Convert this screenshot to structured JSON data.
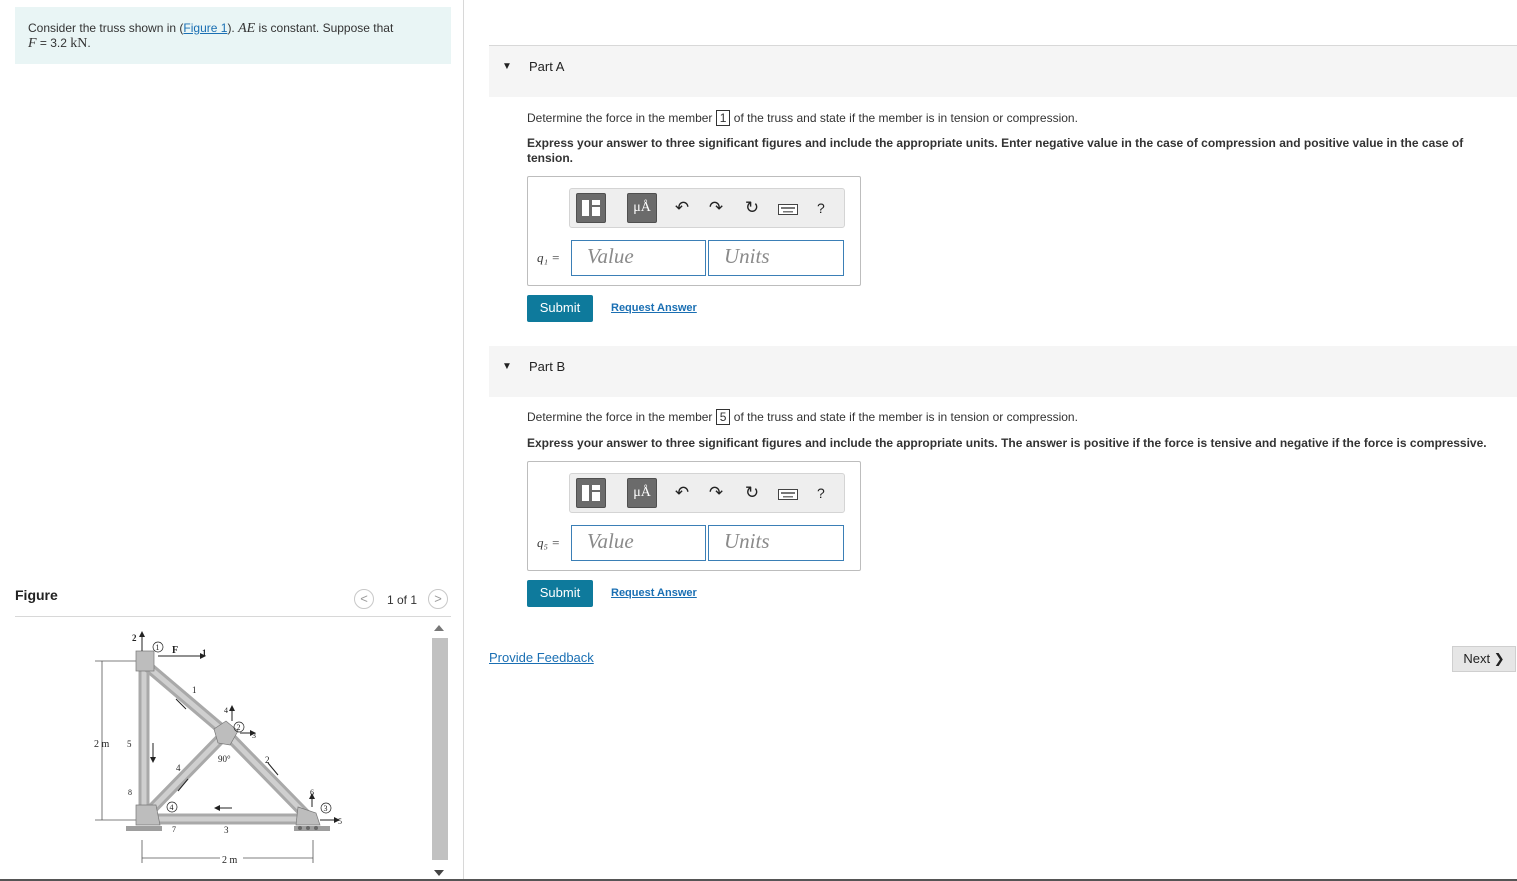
{
  "intro": {
    "text_before_link": "Consider the truss shown in (",
    "figure_link": "Figure 1",
    "text_after_link": "). ",
    "ae_symbol": "AE",
    "text_constant": " is constant. Suppose that",
    "f_symbol": "F",
    "f_equals": " = 3.2 ",
    "f_unit": "kN",
    "period": "."
  },
  "figure": {
    "title": "Figure",
    "prev_icon": "<",
    "next_icon": ">",
    "count": "1 of 1",
    "diagram": {
      "height_label": "2 m",
      "width_label": "2 m",
      "angle_label": "90°",
      "force_label": "F",
      "member_labels": [
        "1",
        "2",
        "3",
        "4",
        "5"
      ],
      "joint_labels": [
        "1",
        "2",
        "3",
        "4"
      ],
      "dof_labels": [
        "1",
        "2",
        "3",
        "4",
        "5",
        "6",
        "7",
        "8"
      ]
    }
  },
  "part_a": {
    "label": "Part A",
    "prompt_before": "Determine the force in the member ",
    "member": "1",
    "prompt_after": " of the truss and state if the member is in tension or compression.",
    "instructions": "Express your answer to three significant figures and include the appropriate units. Enter negative value in the case of compression and positive value in the case of tension.",
    "var_label": "q₁ =",
    "value_placeholder": "Value",
    "units_placeholder": "Units",
    "submit_label": "Submit",
    "request_label": "Request Answer"
  },
  "part_b": {
    "label": "Part B",
    "prompt_before": "Determine the force in the member ",
    "member": "5",
    "prompt_after": " of the truss and state if the member is in tension or compression.",
    "instructions": "Express your answer to three significant figures and include the appropriate units. The answer is positive if the force is tensive and negative if the force is compressive.",
    "var_label": "q₅ =",
    "value_placeholder": "Value",
    "units_placeholder": "Units",
    "submit_label": "Submit",
    "request_label": "Request Answer"
  },
  "toolbar": {
    "units_button_label": "μÅ",
    "help_label": "?",
    "icons": [
      "templates-icon",
      "units-icon",
      "undo-icon",
      "redo-icon",
      "reset-icon",
      "keyboard-icon",
      "help-icon"
    ]
  },
  "footer": {
    "feedback_link": "Provide Feedback",
    "next_label": "Next",
    "next_icon": "❯"
  }
}
